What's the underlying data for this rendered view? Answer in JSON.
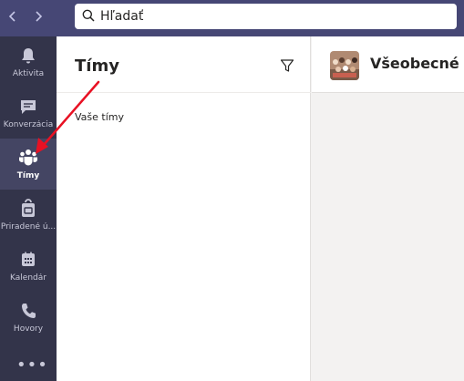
{
  "search": {
    "placeholder": "Hľadať"
  },
  "rail": {
    "items": [
      {
        "label": "Aktivita",
        "icon": "bell-icon"
      },
      {
        "label": "Konverzácia",
        "icon": "chat-icon"
      },
      {
        "label": "Tímy",
        "icon": "teams-icon",
        "active": true
      },
      {
        "label": "Priradené ú...",
        "icon": "assignments-icon"
      },
      {
        "label": "Kalendár",
        "icon": "calendar-icon"
      },
      {
        "label": "Hovory",
        "icon": "phone-icon"
      }
    ],
    "more": "•••"
  },
  "panel": {
    "title": "Tímy",
    "section": "Vaše tímy"
  },
  "main": {
    "channel": "Všeobecné"
  },
  "colors": {
    "topbar": "#464775",
    "rail": "#33344a",
    "rail_active": "#444563",
    "annotation_arrow": "#e81123"
  }
}
